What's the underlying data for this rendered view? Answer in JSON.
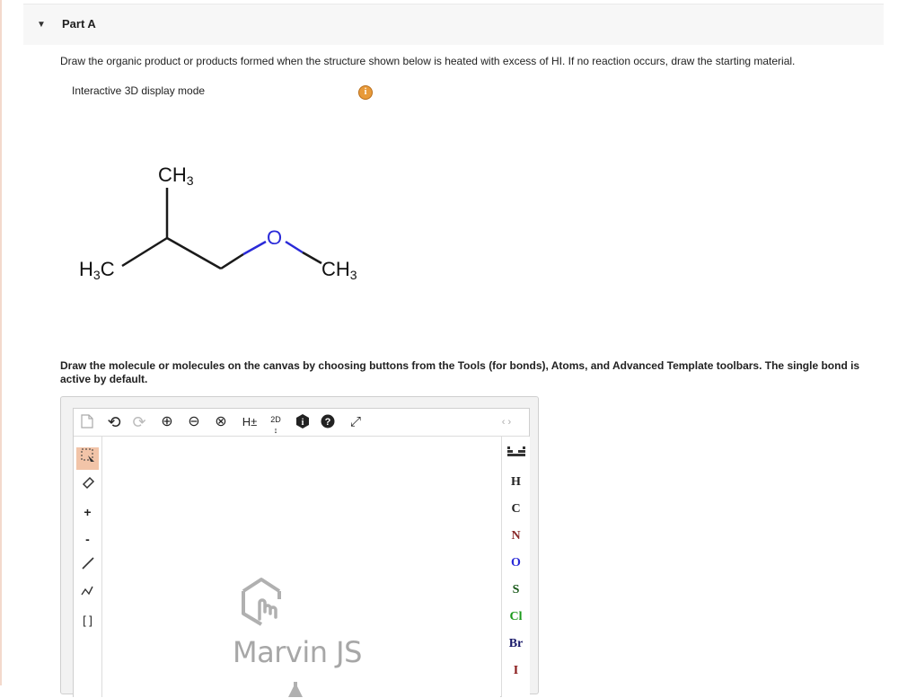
{
  "part": {
    "toggle_icon": "caret-down-icon",
    "title": "Part A"
  },
  "question": {
    "prompt": "Draw the organic product or products formed when the structure shown below is heated with excess of HI. If no reaction occurs, draw the starting material.",
    "display_mode_label": "Interactive 3D display mode",
    "info_icon": "info-icon",
    "molecule": {
      "labels": {
        "top_methyl": "CH",
        "top_methyl_sub": "3",
        "left_methyl_pre": "H",
        "left_methyl_sub": "3",
        "left_methyl_post": "C",
        "oxygen": "O",
        "right_methyl": "CH",
        "right_methyl_sub": "3"
      },
      "colors": {
        "bond": "#1a1a1a",
        "oxygen": "#2a2ad8"
      }
    }
  },
  "instructions": "Draw the molecule or molecules on the canvas by choosing buttons from the Tools (for bonds), Atoms, and Advanced Template toolbars. The single bond is active by default.",
  "editor": {
    "brand": "Marvin JS",
    "top_tools": [
      {
        "name": "new-document-icon",
        "glyph": "🗋"
      },
      {
        "name": "undo-icon",
        "glyph": "↶"
      },
      {
        "name": "redo-icon",
        "glyph": "↷"
      },
      {
        "name": "zoom-in-icon",
        "glyph": "⊕"
      },
      {
        "name": "zoom-out-icon",
        "glyph": "⊖"
      },
      {
        "name": "clear-icon",
        "glyph": "⊗"
      },
      {
        "name": "hydrogen-toggle",
        "glyph": "H±"
      },
      {
        "name": "clean-2d-icon",
        "glyph": "2D"
      },
      {
        "name": "info-icon",
        "glyph": "i"
      },
      {
        "name": "help-icon",
        "glyph": "?"
      },
      {
        "name": "fullscreen-icon",
        "glyph": "⤢"
      }
    ],
    "left_tools": [
      {
        "name": "selection-tool-icon",
        "glyph": "⬚",
        "active": true
      },
      {
        "name": "eraser-icon",
        "glyph": "⌀"
      },
      {
        "name": "increase-charge-icon",
        "glyph": "+"
      },
      {
        "name": "decrease-charge-icon",
        "glyph": "-"
      },
      {
        "name": "single-bond-icon",
        "glyph": "╱"
      },
      {
        "name": "chain-icon",
        "glyph": "∿"
      },
      {
        "name": "bracket-icon",
        "glyph": "[ ]"
      }
    ],
    "periodic_table_icon": "periodic-table-icon",
    "nav_arrows": "‹ ›",
    "atoms": [
      {
        "symbol": "H",
        "color": "#1a1a1a"
      },
      {
        "symbol": "C",
        "color": "#1a1a1a"
      },
      {
        "symbol": "N",
        "color": "#2a2ad8"
      },
      {
        "symbol": "O",
        "color": "#d82a2a"
      },
      {
        "symbol": "S",
        "color": "#7a7a1a"
      },
      {
        "symbol": "Cl",
        "color": "#1a9a1a"
      },
      {
        "symbol": "Br",
        "color": "#8a2a2a"
      },
      {
        "symbol": "I",
        "color": "#6a1a8a"
      }
    ]
  }
}
